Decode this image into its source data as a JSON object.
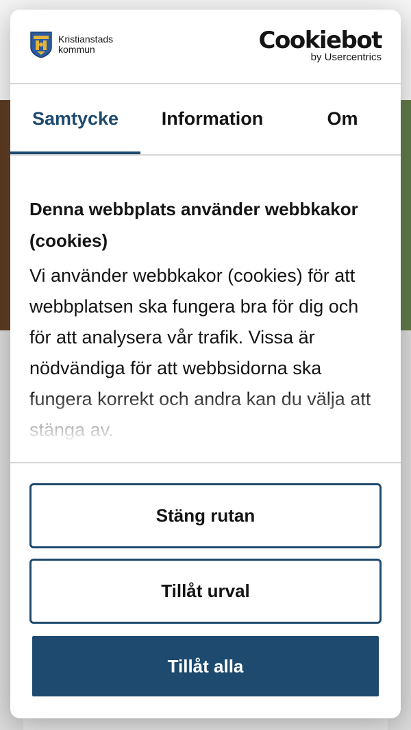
{
  "brand": {
    "municipality_line1": "Kristianstads",
    "municipality_line2": "kommun",
    "cookiebot_name": "Cookiebot",
    "cookiebot_by": "by Usercentrics"
  },
  "tabs": [
    {
      "label": "Samtycke",
      "active": true
    },
    {
      "label": "Information",
      "active": false
    },
    {
      "label": "Om",
      "active": false
    }
  ],
  "content": {
    "heading": "Denna webbplats använder webbkakor (cookies)",
    "body": "Vi använder webbkakor (cookies) för att webbplatsen ska fungera bra för dig och för att analysera vår trafik. Vissa är nödvändiga för att webbsidorna ska fungera korrekt och andra kan du välja att stänga av."
  },
  "buttons": {
    "close": "Stäng rutan",
    "allow_selection": "Tillåt urval",
    "allow_all": "Tillåt alla"
  },
  "colors": {
    "accent": "#1d4a6e",
    "text": "#141414",
    "divider": "#d6d6d6"
  },
  "icons": {
    "crest": "kristianstad-crest-icon"
  }
}
